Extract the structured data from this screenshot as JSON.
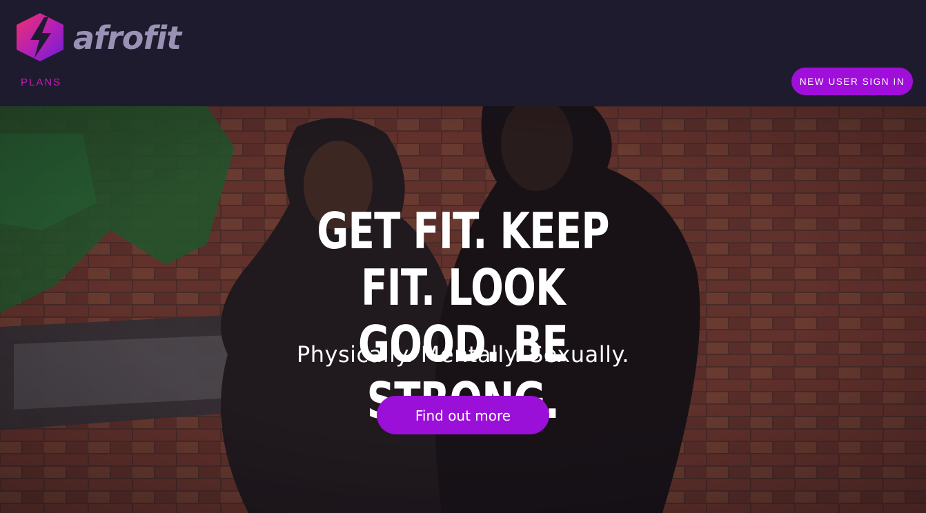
{
  "header": {
    "logo_text": "afrofit",
    "nav": {
      "plans_label": "PLANS"
    },
    "signin_label": "NEW USER SIGN IN"
  },
  "hero": {
    "headline": "GET FIT. KEEP FIT. LOOK GOOD. BE STRONG.",
    "subline": "Physically. Mentally. Sexually.",
    "cta_label": "Find out more"
  },
  "colors": {
    "header_bg": "#1e1b2e",
    "accent_purple": "#9f0fd9",
    "nav_magenta": "#c21fb6",
    "logo_pink": "#e8336d",
    "logo_purple": "#7a1fd1"
  }
}
